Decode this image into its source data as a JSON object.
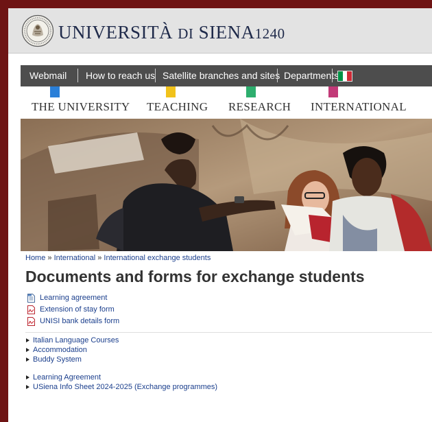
{
  "header": {
    "logo_name": "seal-logo",
    "university_prefix": "UNIVERSITÀ",
    "university_di": "DI",
    "university_name": "SIENA",
    "founded": "1240"
  },
  "topnav": {
    "items": [
      "Webmail",
      "How to reach us",
      "Satellite branches and sites",
      "Departments"
    ],
    "flag_colors": [
      "#009246",
      "#ffffff",
      "#ce2b37"
    ]
  },
  "mainmenu": {
    "items": [
      {
        "label": "THE UNIVERSITY",
        "color": "#2a7fd8"
      },
      {
        "label": "TEACHING",
        "color": "#f1c21b"
      },
      {
        "label": "RESEARCH",
        "color": "#2eae6e"
      },
      {
        "label": "INTERNATIONAL",
        "color": "#c23a78"
      }
    ]
  },
  "breadcrumb": {
    "items": [
      "Home",
      "International",
      "International exchange students"
    ],
    "separator": "»"
  },
  "page_title": "Documents and forms for exchange students",
  "documents": [
    {
      "label": "Learning agreement",
      "icon": "doc-file-icon"
    },
    {
      "label": "Extension of stay form",
      "icon": "pdf-file-icon"
    },
    {
      "label": "UNISI bank details form",
      "icon": "pdf-file-icon"
    }
  ],
  "links_group_1": [
    "Italian Language Courses",
    "Accommodation",
    "Buddy System"
  ],
  "links_group_2": [
    "Learning Agreement",
    "USiena Info Sheet 2024-2025 (Exchange programmes)"
  ]
}
